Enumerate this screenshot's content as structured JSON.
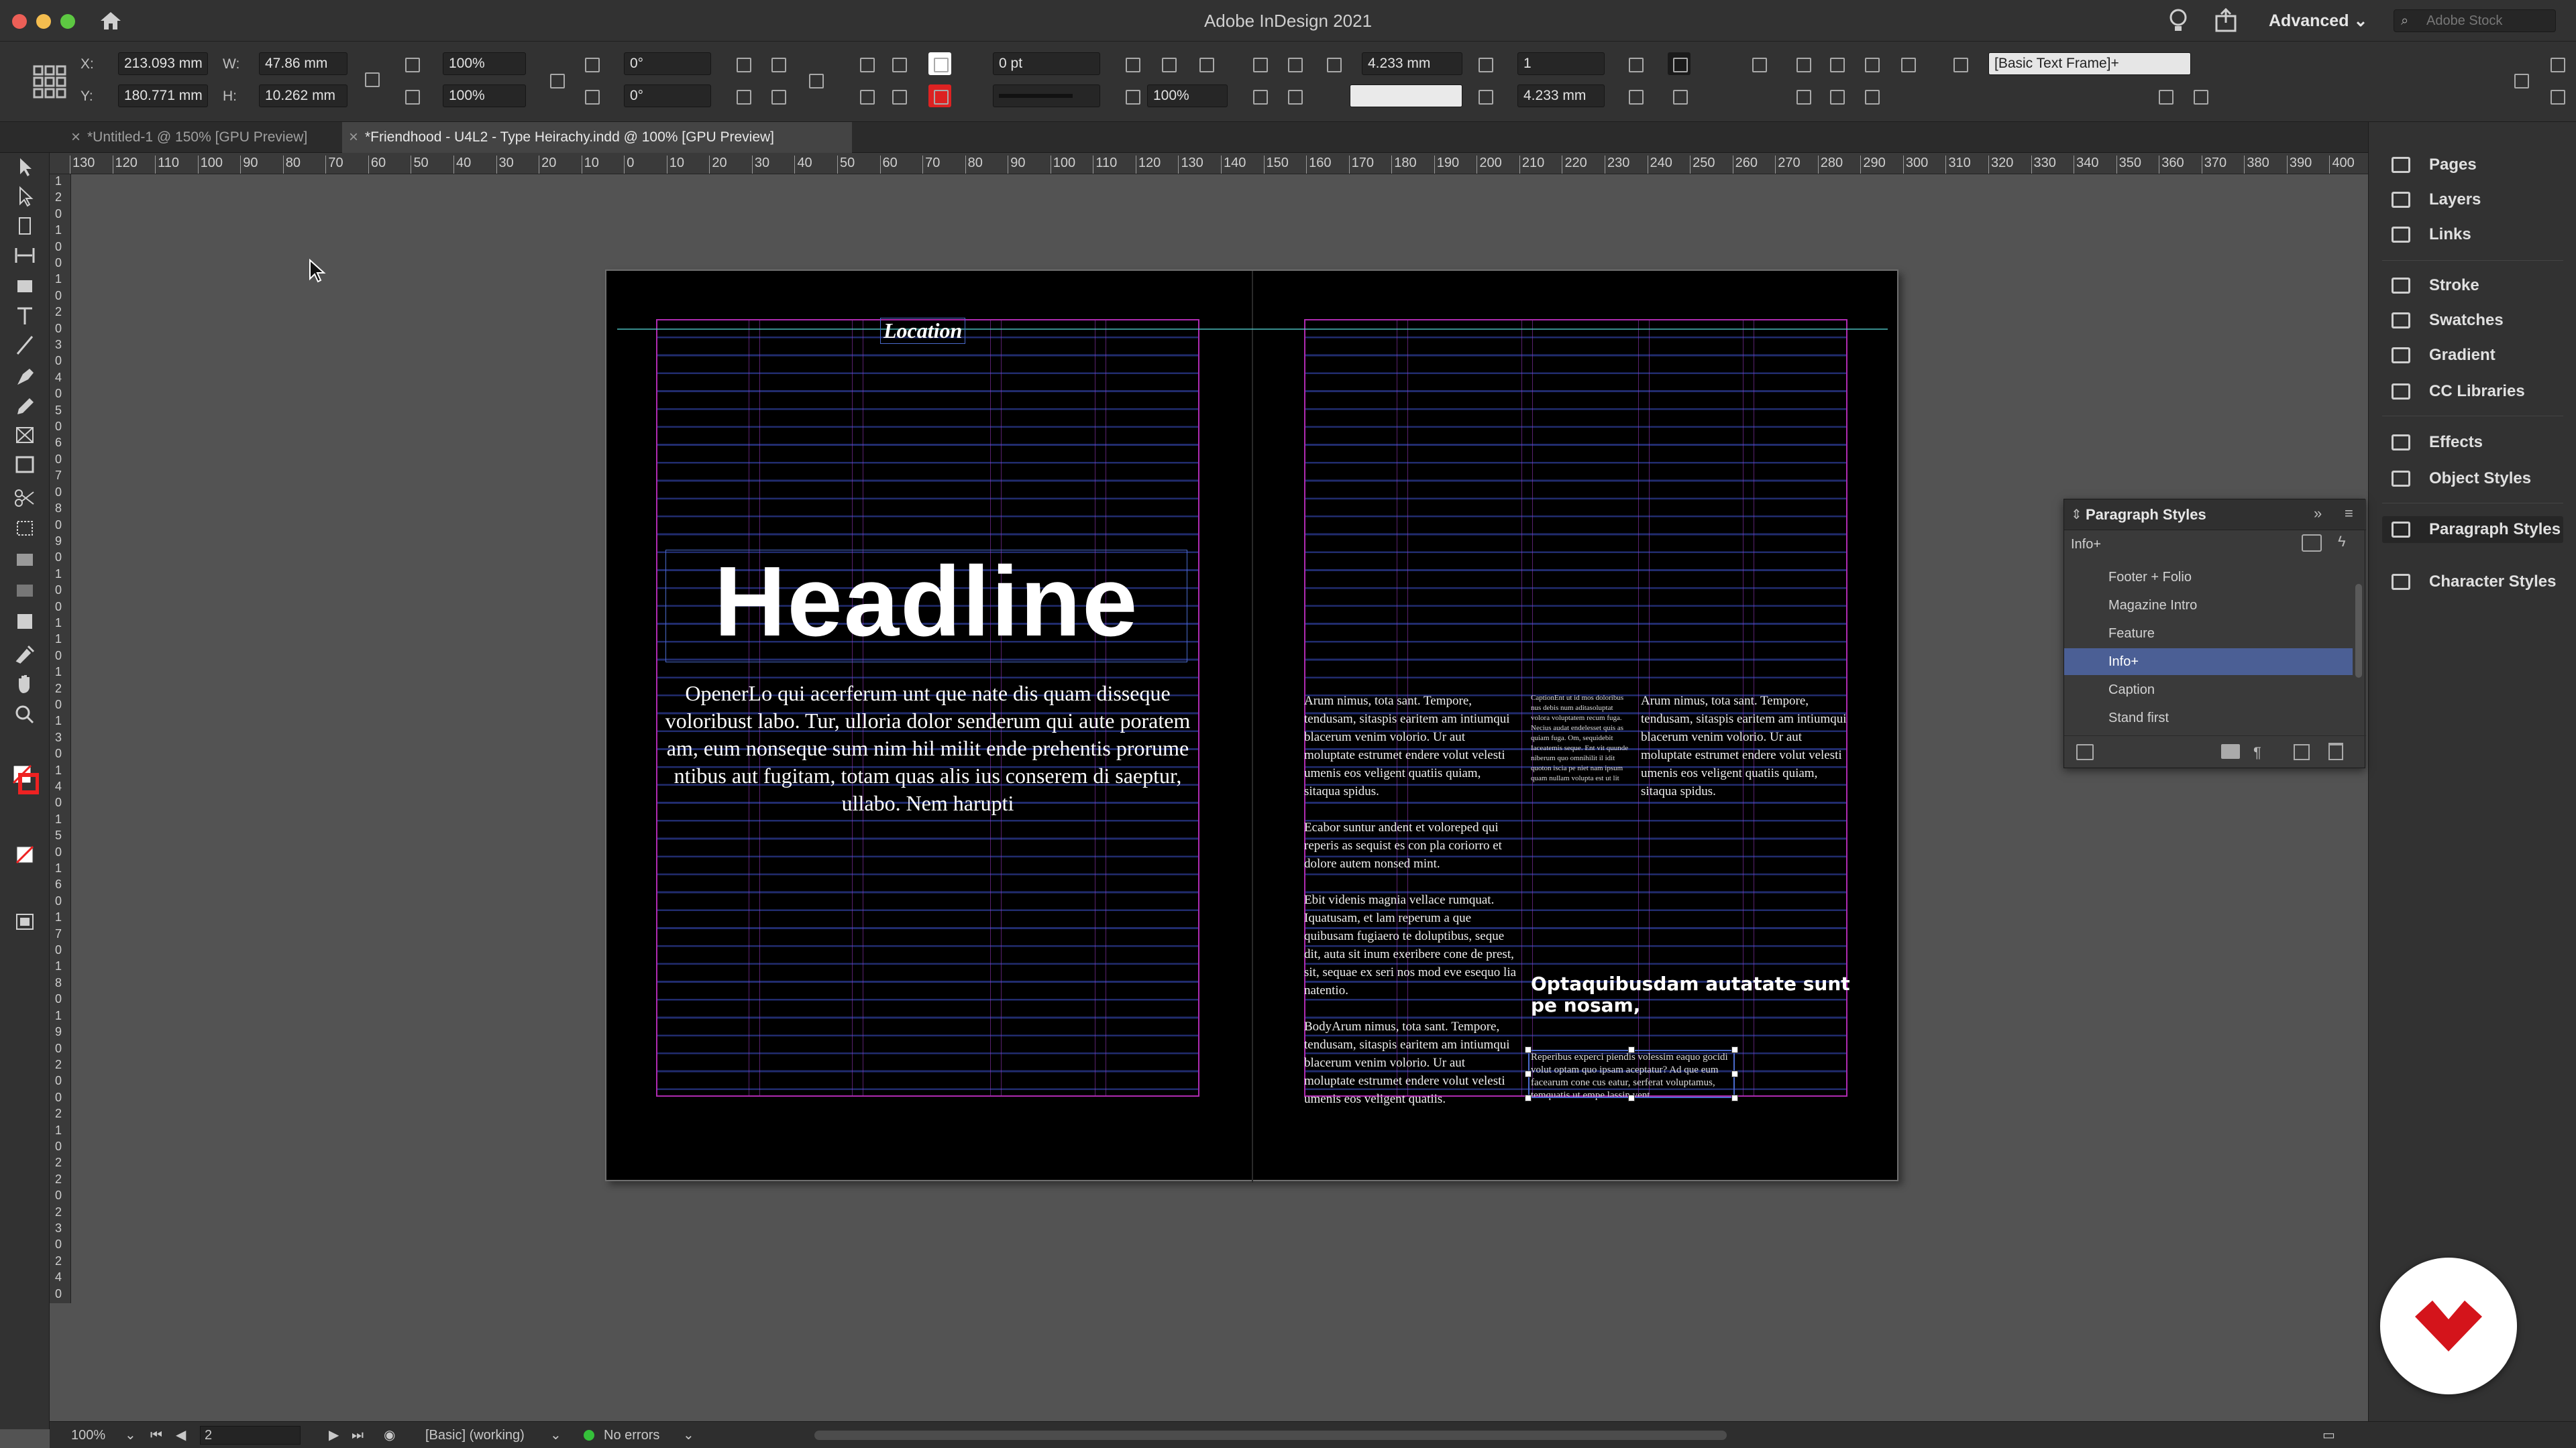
{
  "window": {
    "title": "Adobe InDesign 2021",
    "workspace": "Advanced",
    "stock_placeholder": "Adobe Stock",
    "traffic_colors": [
      "#ec5f57",
      "#f4bd4f",
      "#5dc842"
    ]
  },
  "control_panel": {
    "x_label": "X:",
    "y_label": "Y:",
    "w_label": "W:",
    "h_label": "H:",
    "x": "213.093 mm",
    "y": "180.771 mm",
    "w": "47.86 mm",
    "h": "10.262 mm",
    "scale_x": "100%",
    "scale_y": "100%",
    "rotate": "0°",
    "shear": "0°",
    "stroke_weight": "0 pt",
    "opacity": "100%",
    "gutter_width": "4.233 mm",
    "gutter_height": "4.233 mm",
    "columns": "1",
    "col_spacing": "4.233 mm",
    "object_style": "[Basic Text Frame]+"
  },
  "tabs": [
    {
      "label": "*Untitled-1 @ 150% [GPU Preview]",
      "active": false
    },
    {
      "label": "*Friendhood - U4L2 - Type Heirachy.indd @ 100% [GPU Preview]",
      "active": true
    }
  ],
  "ruler_h": [
    "130",
    "120",
    "110",
    "100",
    "90",
    "80",
    "70",
    "60",
    "50",
    "40",
    "30",
    "20",
    "10",
    "0",
    "10",
    "20",
    "30",
    "40",
    "50",
    "60",
    "70",
    "80",
    "90",
    "100",
    "110",
    "120",
    "130",
    "140",
    "150",
    "160",
    "170",
    "180",
    "190",
    "200",
    "210",
    "220",
    "230",
    "240",
    "250",
    "260",
    "270",
    "280",
    "290",
    "300",
    "310",
    "320",
    "330",
    "340",
    "350",
    "360",
    "370",
    "380",
    "390",
    "400"
  ],
  "ruler_v": [
    "1",
    "2",
    "0",
    "1",
    "0",
    "0",
    "1",
    "0",
    "2",
    "0",
    "3",
    "0",
    "4",
    "0",
    "5",
    "0",
    "6",
    "0",
    "7",
    "0",
    "8",
    "0",
    "9",
    "0",
    "1",
    "0",
    "0",
    "1",
    "1",
    "0",
    "1",
    "2",
    "0",
    "1",
    "3",
    "0",
    "1",
    "4",
    "0",
    "1",
    "5",
    "0",
    "1",
    "6",
    "0",
    "1",
    "7",
    "0",
    "1",
    "8",
    "0",
    "1",
    "9",
    "0",
    "2",
    "0",
    "0",
    "2",
    "1",
    "0",
    "2",
    "2",
    "0",
    "2",
    "3",
    "0",
    "2",
    "4",
    "0"
  ],
  "document": {
    "location": "Location",
    "headline": "Headline",
    "opener": "OpenerLo qui acerferum unt que nate dis quam disseque voloribust labo. Tur, ulloria dolor senderum qui aute poratem am, eum nonseque sum nim hil milit ende prehentis prorume ntibus aut fugitam, totam quas alis ius conserem di saeptur, ullabo. Nem harupti",
    "col1_p1": "Arum nimus, tota sant. Tempore, tendusam, sitaspis earitem am intiumqui blacerum venim volorio. Ur aut moluptate estrumet endere volut velesti umenis eos veligent quatiis quiam, sitaqua spidus.",
    "col1_p2": "Ecabor suntur andent et voloreped qui reperis as sequist es con pla coriorro et dolore autem nonsed mint.",
    "col1_p3": "Ebit videnis magnia vellace rumquat. Iquatusam, et lam reperum a que quibusam fugiaero te doluptibus, seque dit, auta sit inum exeribere cone de prest, sit, sequae ex seri nos mod eve esequo lia natentio.",
    "col1_p4": "BodyArum nimus, tota sant. Tempore, tendusam, sitaspis earitem am intiumqui blacerum venim volorio. Ur aut moluptate estrumet endere volut velesti umenis eos veligent quatiis.",
    "caption": "CaptionEnt ut id mos doloribus nus debis num aditasoluptat volora voluptatem recum fuga. Necius audat endelesset quis as quiam fuga. Om, sequidebit Iaceatemis seque. Ent vit quunde niberum quo omnihilit il idit quoton iscia pe niet nam ipsum quam nullam volupta est ut lit",
    "col3_p1": "Arum nimus, tota sant. Tempore, tendusam, sitaspis earitem am intiumqui blacerum venim volorio. Ur aut moluptate estrumet endere volut velesti umenis eos veligent quatiis quiam, sitaqua spidus.",
    "pull_quote": "Optaquibusdam autatate sunt pe nosam,",
    "info": "Reperibus experci piendis volessim eaquo gocidi volut optam quo ipsam aceptatur? Ad que eum facearum cone cus eatur, serferat voluptamus, temquatis ut empe lassin vent."
  },
  "dock": {
    "items": [
      "Pages",
      "Layers",
      "Links",
      "Stroke",
      "Swatches",
      "Gradient",
      "CC Libraries",
      "Effects",
      "Object Styles",
      "Paragraph Styles",
      "Character Styles"
    ]
  },
  "paragraph_styles": {
    "title": "Paragraph Styles",
    "current": "Info+",
    "items": [
      "Footer + Folio",
      "Magazine Intro",
      "Feature",
      "Info+",
      "Caption",
      "Stand first"
    ],
    "selected_index": 3
  },
  "status": {
    "zoom": "100%",
    "page": "2",
    "profile": "[Basic] (working)",
    "preflight": "No errors",
    "preflight_color": "#35c03a"
  },
  "colors": {
    "accent_selected": "#4b5f95",
    "margin_guide": "#ae2bb0",
    "frame_edge": "#4a6acb",
    "logo_red": "#d4141b"
  }
}
